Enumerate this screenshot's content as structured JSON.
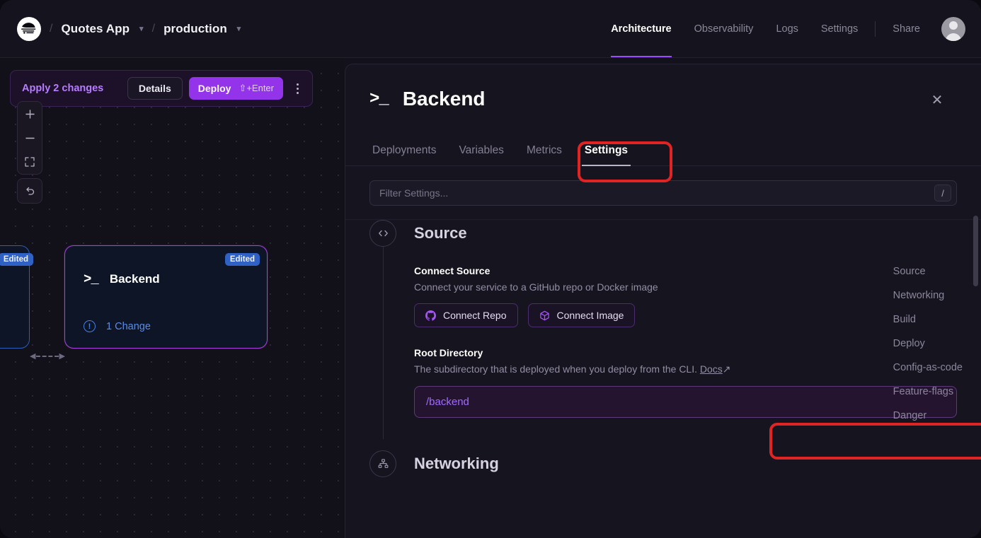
{
  "header": {
    "logo_icon": "railway-logo-icon",
    "breadcrumb": {
      "separator": "/",
      "project": "Quotes App",
      "environment": "production",
      "chevron_icon": "chevron-down-icon"
    },
    "nav": [
      {
        "label": "Architecture",
        "active": true
      },
      {
        "label": "Observability",
        "active": false
      },
      {
        "label": "Logs",
        "active": false
      },
      {
        "label": "Settings",
        "active": false
      }
    ],
    "share_label": "Share",
    "avatar_icon": "user-avatar-icon",
    "active_accent": "#9a4dff"
  },
  "canvas": {
    "changes_bar": {
      "apply_label": "Apply 2 changes",
      "details_label": "Details",
      "deploy_label": "Deploy",
      "deploy_shortcut": "⇧+Enter",
      "kebab_icon": "more-vertical-icon",
      "accent": "#9333ea"
    },
    "controls": [
      {
        "name": "zoom-in-button",
        "icon": "plus-icon",
        "glyph": "+"
      },
      {
        "name": "zoom-out-button",
        "icon": "minus-icon",
        "glyph": "−"
      },
      {
        "name": "fit-view-button",
        "icon": "fit-screen-icon",
        "glyph": "⛶"
      },
      {
        "name": "undo-button",
        "icon": "undo-arrow-icon",
        "glyph": "↰"
      }
    ],
    "nodes": [
      {
        "name": "node-partial",
        "badge": "Edited",
        "badge_color": "#2f62c4",
        "border_color": "#2c5fb8"
      },
      {
        "name": "node-backend",
        "title": "Backend",
        "icon": "terminal-icon",
        "badge": "Edited",
        "change_count_label": "1 Change",
        "change_icon": "alert-circle-icon",
        "border_color": "#a340d8"
      }
    ],
    "edge": {
      "name": "service-connection-edge",
      "style": "dashed-bidirectional"
    }
  },
  "panel": {
    "title": "Backend",
    "icon": "terminal-icon",
    "close_icon": "close-icon",
    "tabs": [
      {
        "label": "Deployments",
        "active": false
      },
      {
        "label": "Variables",
        "active": false
      },
      {
        "label": "Metrics",
        "active": false
      },
      {
        "label": "Settings",
        "active": true
      }
    ],
    "filter": {
      "placeholder": "Filter Settings...",
      "shortcut_key": "/"
    },
    "source_section": {
      "title": "Source",
      "icon": "code-brackets-icon",
      "connect_source": {
        "label": "Connect Source",
        "description": "Connect your service to a GitHub repo or Docker image",
        "buttons": [
          {
            "label": "Connect Repo",
            "icon": "github-icon"
          },
          {
            "label": "Connect Image",
            "icon": "docker-cube-icon"
          }
        ]
      },
      "root_directory": {
        "label": "Root Directory",
        "description": "The subdirectory that is deployed when you deploy from the CLI.",
        "docs_link": "Docs",
        "docs_arrow": "↗",
        "value": "/backend",
        "value_color": "#a06bff"
      }
    },
    "networking_section": {
      "title": "Networking",
      "icon": "network-nodes-icon"
    },
    "side_nav": [
      {
        "label": "Source"
      },
      {
        "label": "Networking"
      },
      {
        "label": "Build"
      },
      {
        "label": "Deploy"
      },
      {
        "label": "Config-as-code"
      },
      {
        "label": "Feature-flags"
      },
      {
        "label": "Danger"
      }
    ],
    "scrollbar": {
      "name": "panel-scrollbar"
    }
  },
  "annotations": {
    "color": "#e02424",
    "items": [
      {
        "name": "settings-tab-highlight"
      },
      {
        "name": "root-directory-input-highlight"
      }
    ]
  }
}
